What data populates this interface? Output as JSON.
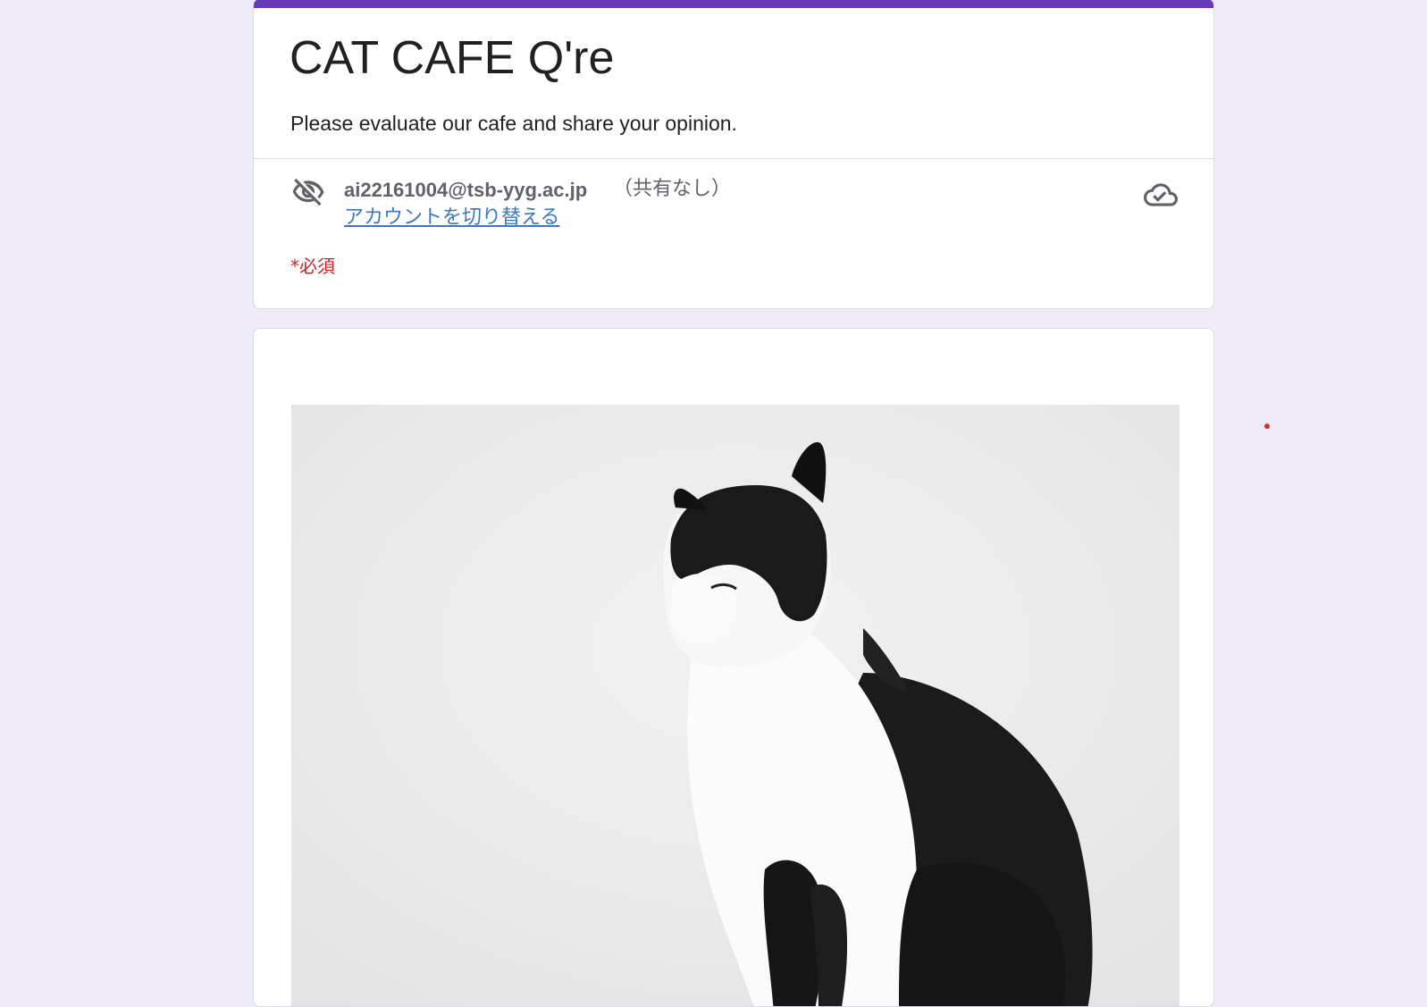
{
  "form": {
    "title": "CAT CAFE Q're",
    "description": "Please evaluate our cafe and share your opinion.",
    "accent_color": "#673ab7",
    "background_color": "#f0ebf8"
  },
  "account": {
    "email": "ai22161004@tsb-yyg.ac.jp",
    "sharing_note": "（共有なし）",
    "switch_label": "アカウントを切り替える",
    "visibility_icon": "eye-off-icon",
    "save_status_icon": "cloud-done-icon"
  },
  "required_note": "*必須",
  "image_section": {
    "image_subject": "black-and-white cat photo"
  }
}
